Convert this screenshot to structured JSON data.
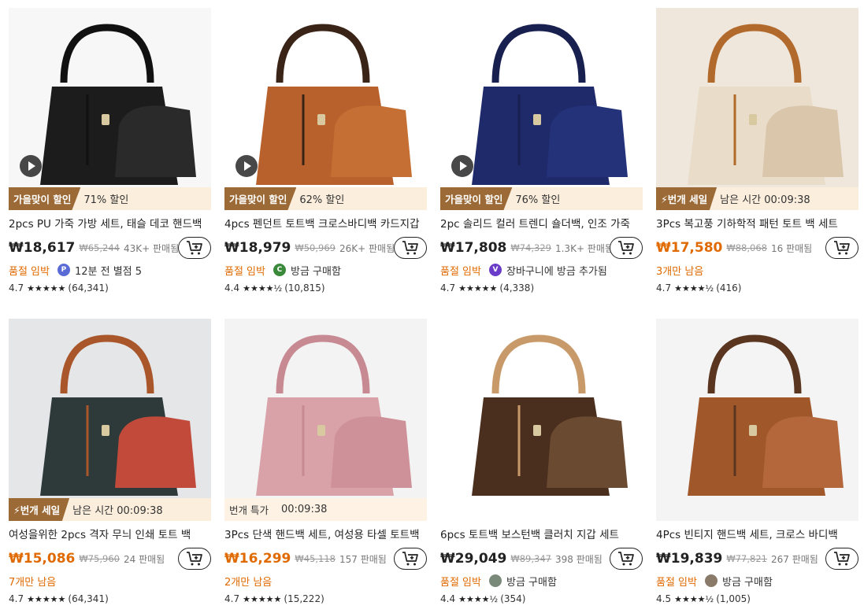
{
  "products": [
    {
      "promo_tag": "가을맞이 할인",
      "promo_text": "71% 할인",
      "promo_style": "autumn",
      "title": "2pcs PU 가죽 가방 세트, 태슬 데코 핸드백",
      "price": "₩18,617",
      "orig": "₩65,244",
      "sold": "43K+ 판매됨",
      "price_orange": false,
      "hot": "품절 임박",
      "avatar": "P",
      "avatar_color": "#5a6bd6",
      "activity": "12분 전 별점 5",
      "rating": "4.7",
      "stars": "★★★★★",
      "reviews": "(64,341)",
      "video": true,
      "colors": {
        "bg": "#f7f7f7",
        "bag": "#1c1c1c",
        "bag2": "#2a2a2a",
        "handle": "#111"
      }
    },
    {
      "promo_tag": "가을맞이 할인",
      "promo_text": "62% 할인",
      "promo_style": "autumn",
      "title": "4pcs 펜던트 토트백 크로스바디백 카드지갑",
      "price": "₩18,979",
      "orig": "₩50,969",
      "sold": "26K+ 판매됨",
      "price_orange": false,
      "hot": "품절 임박",
      "avatar": "C",
      "avatar_color": "#3b8a3b",
      "activity": "방금 구매함",
      "rating": "4.4",
      "stars": "★★★★½",
      "reviews": "(10,815)",
      "video": true,
      "colors": {
        "bg": "#ffffff",
        "bag": "#b8612c",
        "bag2": "#c56f34",
        "handle": "#3a2418"
      }
    },
    {
      "promo_tag": "가을맞이 할인",
      "promo_text": "76% 할인",
      "promo_style": "autumn",
      "title": "2pc 솔리드 컬러 트렌디 숄더백, 인조 가죽",
      "price": "₩17,808",
      "orig": "₩74,329",
      "sold": "1.3K+ 판매됨",
      "price_orange": false,
      "hot": "품절 임박",
      "avatar": "V",
      "avatar_color": "#6a3cc8",
      "activity": "장바구니에 방금 추가됨",
      "rating": "4.7",
      "stars": "★★★★★",
      "reviews": "(4,338)",
      "video": true,
      "colors": {
        "bg": "#ffffff",
        "bag": "#1f2a6b",
        "bag2": "#24327a",
        "handle": "#18204f"
      }
    },
    {
      "promo_tag": "번개 세일",
      "promo_text": "남은 시간 00:09:38",
      "promo_style": "flash",
      "title": "3Pcs 복고풍 기하학적 패턴 토트 백 세트",
      "price": "₩17,580",
      "orig": "₩88,068",
      "sold": "16 판매됨",
      "price_orange": true,
      "hot": "",
      "avatar": "",
      "avatar_color": "",
      "activity": "",
      "remain": "3개만 남음",
      "rating": "4.7",
      "stars": "★★★★½",
      "reviews": "(416)",
      "video": false,
      "colors": {
        "bg": "#efe7dc",
        "bag": "#e9dcc9",
        "bag2": "#d9c6ab",
        "handle": "#b26a2c"
      }
    },
    {
      "promo_tag": "번개 세일",
      "promo_text": "남은 시간 00:09:38",
      "promo_style": "flash",
      "title": "여성을위한 2pcs 격자 무늬 인쇄 토트 백",
      "price": "₩15,086",
      "orig": "₩75,960",
      "sold": "24 판매됨",
      "price_orange": true,
      "hot": "",
      "avatar": "",
      "avatar_color": "",
      "activity": "",
      "remain": "7개만 남음",
      "rating": "4.7",
      "stars": "★★★★★",
      "reviews": "(64,341)",
      "video": false,
      "colors": {
        "bg": "#e4e6e8",
        "bag": "#2e3a3a",
        "bag2": "#c24a3a",
        "handle": "#a9562a"
      }
    },
    {
      "promo_tag": "번개 특가",
      "promo_text": "00:09:38",
      "promo_style": "light",
      "title": "3Pcs 단색 핸드백 세트, 여성용 타셀 토트백",
      "price": "₩16,299",
      "orig": "₩45,118",
      "sold": "157 판매됨",
      "price_orange": true,
      "hot": "",
      "avatar": "",
      "avatar_color": "",
      "activity": "",
      "remain": "2개만 남음",
      "rating": "4.7",
      "stars": "★★★★★",
      "reviews": "(15,222)",
      "video": false,
      "colors": {
        "bg": "#f3f3f3",
        "bag": "#d9a2a8",
        "bag2": "#cf9199",
        "handle": "#c88a92"
      }
    },
    {
      "promo_tag": "",
      "promo_text": "",
      "promo_style": "none",
      "title": "6pcs 토트백 보스턴백 클러치 지갑 세트",
      "price": "₩29,049",
      "orig": "₩89,347",
      "sold": "398 판매됨",
      "price_orange": false,
      "hot": "품절 임박",
      "avatar": "",
      "avatar_color": "#7a8a7a",
      "activity": "방금 구매함",
      "rating": "4.4",
      "stars": "★★★★½",
      "reviews": "(354)",
      "video": false,
      "colors": {
        "bg": "#ffffff",
        "bag": "#4a2e1e",
        "bag2": "#6b4a32",
        "handle": "#c89a6a"
      }
    },
    {
      "promo_tag": "",
      "promo_text": "",
      "promo_style": "none",
      "title": "4Pcs 빈티지 핸드백 세트, 크로스 바디백",
      "price": "₩19,839",
      "orig": "₩77,821",
      "sold": "267 판매됨",
      "price_orange": false,
      "hot": "품절 임박",
      "avatar": "",
      "avatar_color": "#8a7a6a",
      "activity": "방금 구매함",
      "rating": "4.5",
      "stars": "★★★★½",
      "reviews": "(1,005)",
      "video": false,
      "colors": {
        "bg": "#f4f4f4",
        "bag": "#a0582a",
        "bag2": "#b4673a",
        "handle": "#5a3520"
      }
    }
  ]
}
